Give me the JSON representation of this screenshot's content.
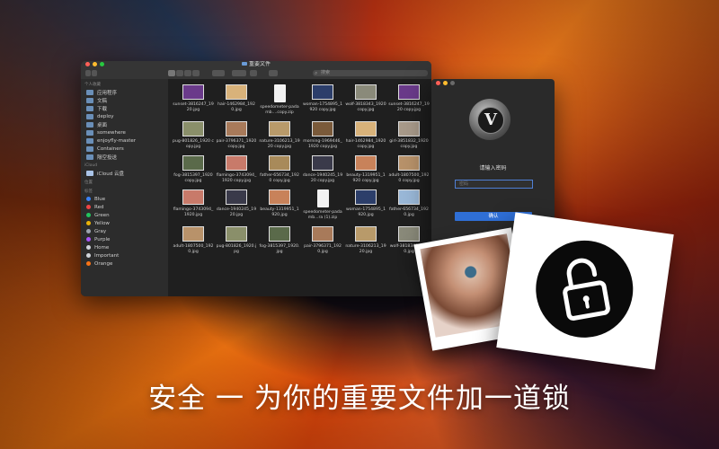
{
  "finder": {
    "title": "重要文件",
    "search_placeholder": "搜索",
    "sidebar": {
      "favorites_header": "个人收藏",
      "favorites": [
        "应用程序",
        "文稿",
        "下载",
        "deploy",
        "桌面",
        "somewhere",
        "enjoyfly-master",
        "Containers",
        "隔空投送"
      ],
      "icloud_header": "iCloud",
      "icloud": [
        "iCloud 云盘"
      ],
      "locations_header": "位置",
      "tags_header": "标签",
      "tags": [
        {
          "label": "Blue",
          "color": "#3b82f6"
        },
        {
          "label": "Red",
          "color": "#ef4444"
        },
        {
          "label": "Green",
          "color": "#22c55e"
        },
        {
          "label": "Yellow",
          "color": "#eab308"
        },
        {
          "label": "Gray",
          "color": "#9ca3af"
        },
        {
          "label": "Purple",
          "color": "#a855f7"
        },
        {
          "label": "Home",
          "color": "#d1d5db"
        },
        {
          "label": "Important",
          "color": "#d1d5db"
        },
        {
          "label": "Orange",
          "color": "#f97316"
        }
      ]
    },
    "files": [
      {
        "name": "sunset-3816247_1920.jpg",
        "kind": "img",
        "color": "#6a3a8a"
      },
      {
        "name": "hair-1462984_1920.jpg",
        "kind": "img",
        "color": "#d8b27a"
      },
      {
        "name": "speedometer-padamb....copy.zip",
        "kind": "doc",
        "color": "#f2f2f2"
      },
      {
        "name": "woman-1754895_1920 copy.jpg",
        "kind": "img",
        "color": "#2c3e6a"
      },
      {
        "name": "wolf-3818343_1920 copy.jpg",
        "kind": "img",
        "color": "#8a8a7a"
      },
      {
        "name": "sunset-3816247_1920 copy.jpg",
        "kind": "img",
        "color": "#6a3a8a"
      },
      {
        "name": "pug-801826_1920 copy.jpg",
        "kind": "img",
        "color": "#8a8f6a"
      },
      {
        "name": "pair-3796371_1920 copy.jpg",
        "kind": "img",
        "color": "#a87a5a"
      },
      {
        "name": "nature-3106213_1920 copy.jpg",
        "kind": "img",
        "color": "#b89a6a"
      },
      {
        "name": "morning-1969446_1920 copy.jpg",
        "kind": "img",
        "color": "#7a5a3a"
      },
      {
        "name": "hair-1462984_1920 copy.jpg",
        "kind": "img",
        "color": "#d8b27a"
      },
      {
        "name": "girl-3851832_1920 copy.jpg",
        "kind": "img",
        "color": "#a89a8a"
      },
      {
        "name": "fog-3815397_1920 copy.jpg",
        "kind": "img",
        "color": "#5a6a4a"
      },
      {
        "name": "flamingo-3743094_1920 copy.jpg",
        "kind": "img",
        "color": "#c87a6a"
      },
      {
        "name": "father-656734_1920 copy.jpg",
        "kind": "img",
        "color": "#a88a5a"
      },
      {
        "name": "dance-1940245_1920 copy.jpg",
        "kind": "img",
        "color": "#3a3a4a"
      },
      {
        "name": "beauty-1319951_1920 copy.jpg",
        "kind": "img",
        "color": "#c8825a"
      },
      {
        "name": "adult-1807500_1920 copy.jpg",
        "kind": "img",
        "color": "#b8926a"
      },
      {
        "name": "flamingo-3743094_1920.jpg",
        "kind": "img",
        "color": "#c87a6a"
      },
      {
        "name": "dance-1940245_1920.jpg",
        "kind": "img",
        "color": "#3a3a4a"
      },
      {
        "name": "beauty-1319951_1920.jpg",
        "kind": "img",
        "color": "#c8825a"
      },
      {
        "name": "speedometer-padamb...ra (1).zip",
        "kind": "doc",
        "color": "#f2f2f2"
      },
      {
        "name": "woman-1754895_1920.jpg",
        "kind": "img",
        "color": "#2c3e6a"
      },
      {
        "name": "father-656734_1920.jpg",
        "kind": "img",
        "color": "#9ab8d8"
      },
      {
        "name": "adult-1807500_1920.jpg",
        "kind": "img",
        "color": "#b8926a"
      },
      {
        "name": "pug-801826_1920.jpg",
        "kind": "img",
        "color": "#8a8f6a"
      },
      {
        "name": "fog-3815397_1920.jpg",
        "kind": "img",
        "color": "#5a6a4a"
      },
      {
        "name": "pair-3796371_1920.jpg",
        "kind": "img",
        "color": "#a87a5a"
      },
      {
        "name": "nature-3106213_1920.jpg",
        "kind": "img",
        "color": "#b89a6a"
      },
      {
        "name": "wolf-3818343_1920.jpg",
        "kind": "img",
        "color": "#8a8a7a"
      }
    ]
  },
  "password": {
    "logo_letter": "V",
    "prompt": "请输入密码",
    "field_placeholder": "密码",
    "confirm_label": "确认"
  },
  "tagline": "安全 一 为你的重要文件加一道锁"
}
